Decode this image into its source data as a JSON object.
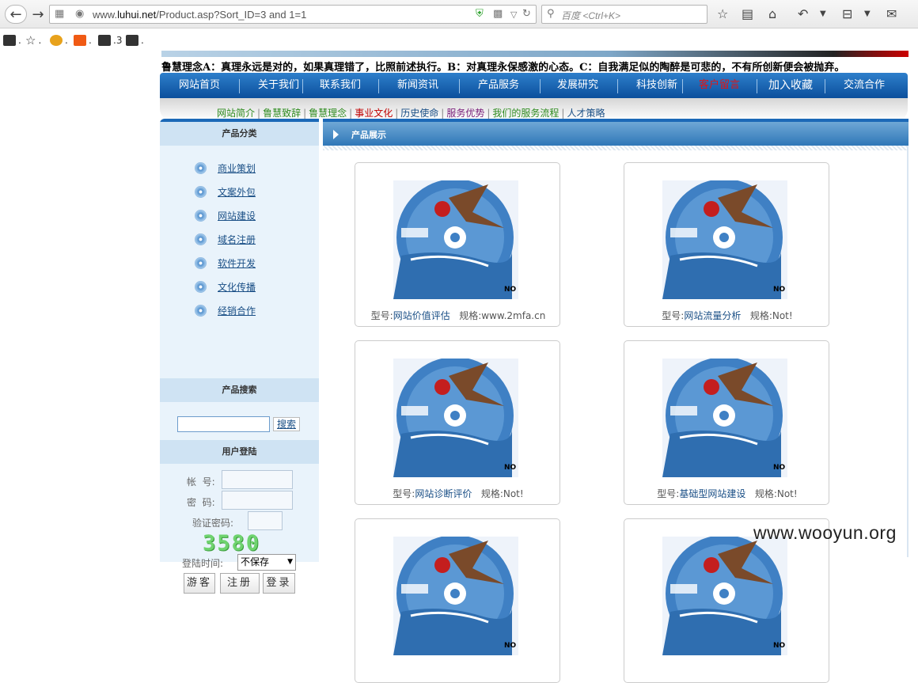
{
  "browser": {
    "url_prefix": "www.",
    "url_domain": "luhui.net",
    "url_path": "/Product.asp?Sort_ID=3 and 1=1",
    "search_placeholder": "百度 <Ctrl+K>",
    "bookmarks": [
      ".",
      ".",
      ".",
      ".",
      ".3",
      "."
    ]
  },
  "site": {
    "slogan": "鲁慧理念A：真理永远是对的，如果真理错了，比照前述执行。B：对真理永保感激的心态。C：自我满足似的陶醉是可悲的，不有所创新便会被抛弃。",
    "nav": [
      "网站首页",
      "关于我们",
      "联系我们",
      "新闻资讯",
      "产品服务",
      "发展研究",
      "科技创新",
      "客户留言",
      "加入收藏",
      "交流合作"
    ],
    "nav_active_index": 7,
    "subnav": [
      {
        "label": "网站简介",
        "color": "#2e8b1f"
      },
      {
        "label": "鲁慧致辞",
        "color": "#2e8b1f"
      },
      {
        "label": "鲁慧理念",
        "color": "#2e8b1f"
      },
      {
        "label": "事业文化",
        "color": "#c00000"
      },
      {
        "label": "历史使命",
        "color": "#1a4f86"
      },
      {
        "label": "服务优势",
        "color": "#7a1f7a"
      },
      {
        "label": "我们的服务流程",
        "color": "#2e8b1f"
      },
      {
        "label": "人才策略",
        "color": "#1a4f86"
      }
    ],
    "sidebar": {
      "category_title": "产品分类",
      "categories": [
        "商业策划",
        "文案外包",
        "网站建设",
        "域名注册",
        "软件开发",
        "文化传播",
        "经销合作"
      ],
      "search_title": "产品搜索",
      "search_button": "搜索",
      "login_title": "用户登陆",
      "account_label": "帐  号:",
      "password_label": "密  码:",
      "captcha_label": "验证密码:",
      "captcha_code": "3580",
      "login_time_label": "登陆时间:",
      "login_time_value": "不保存",
      "guest_button": "游客",
      "register_button": "注册",
      "login_button": "登录"
    },
    "content": {
      "title": "产品展示",
      "products": [
        {
          "model_label": "型号:",
          "model": "网站价值评估",
          "spec_label": "规格:",
          "spec": "www.2mfa.cn"
        },
        {
          "model_label": "型号:",
          "model": "网站流量分析",
          "spec_label": "规格:",
          "spec": "Not!"
        },
        {
          "model_label": "型号:",
          "model": "网站诊断评价",
          "spec_label": "规格:",
          "spec": "Not!"
        },
        {
          "model_label": "型号:",
          "model": "基础型网站建设",
          "spec_label": "规格:",
          "spec": "Not!"
        }
      ],
      "cd_caption": "NO"
    }
  },
  "watermark": "www.wooyun.org"
}
